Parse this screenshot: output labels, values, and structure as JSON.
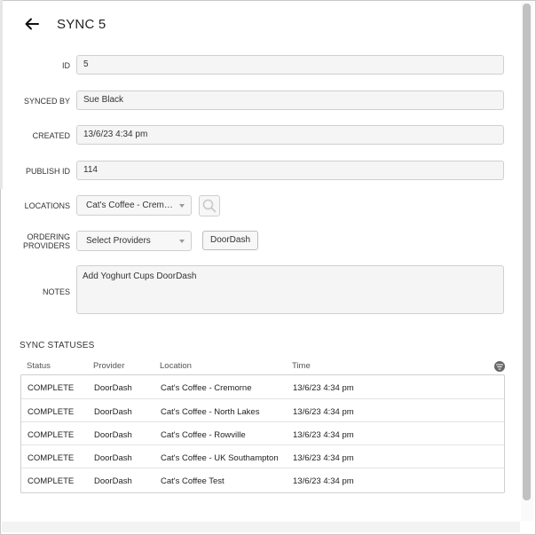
{
  "header": {
    "title": "SYNC 5"
  },
  "form": {
    "id": {
      "label": "ID",
      "value": "5"
    },
    "synced_by": {
      "label": "SYNCED BY",
      "value": "Sue Black"
    },
    "created": {
      "label": "CREATED",
      "value": "13/6/23 4:34 pm"
    },
    "publish_id": {
      "label": "PUBLISH ID",
      "value": "114"
    },
    "locations": {
      "label": "LOCATIONS",
      "selected": "Cat's Coffee - Cremo..."
    },
    "ordering_providers": {
      "label_line1": "ORDERING",
      "label_line2": "PROVIDERS",
      "placeholder": "Select Providers",
      "chips": [
        "DoorDash"
      ]
    },
    "notes": {
      "label": "NOTES",
      "value": "Add Yoghurt Cups DoorDash"
    }
  },
  "sync_statuses": {
    "title": "SYNC STATUSES",
    "columns": [
      "Status",
      "Provider",
      "Location",
      "Time"
    ],
    "rows": [
      {
        "status": "COMPLETE",
        "provider": "DoorDash",
        "location": "Cat's Coffee - Cremorne",
        "time": "13/6/23 4:34 pm"
      },
      {
        "status": "COMPLETE",
        "provider": "DoorDash",
        "location": "Cat's Coffee - North Lakes",
        "time": "13/6/23 4:34 pm"
      },
      {
        "status": "COMPLETE",
        "provider": "DoorDash",
        "location": "Cat's Coffee - Rowville",
        "time": "13/6/23 4:34 pm"
      },
      {
        "status": "COMPLETE",
        "provider": "DoorDash",
        "location": "Cat's Coffee - UK Southampton",
        "time": "13/6/23 4:34 pm"
      },
      {
        "status": "COMPLETE",
        "provider": "DoorDash",
        "location": "Cat's Coffee Test",
        "time": "13/6/23 4:34 pm"
      }
    ]
  },
  "icons": {
    "back": "arrow-left-icon",
    "search": "search-icon",
    "filter": "filter-icon",
    "caret": "chevron-down-icon"
  },
  "colors": {
    "field_background": "#f5f5f5",
    "border": "#cfcfcf",
    "text": "#222222"
  }
}
